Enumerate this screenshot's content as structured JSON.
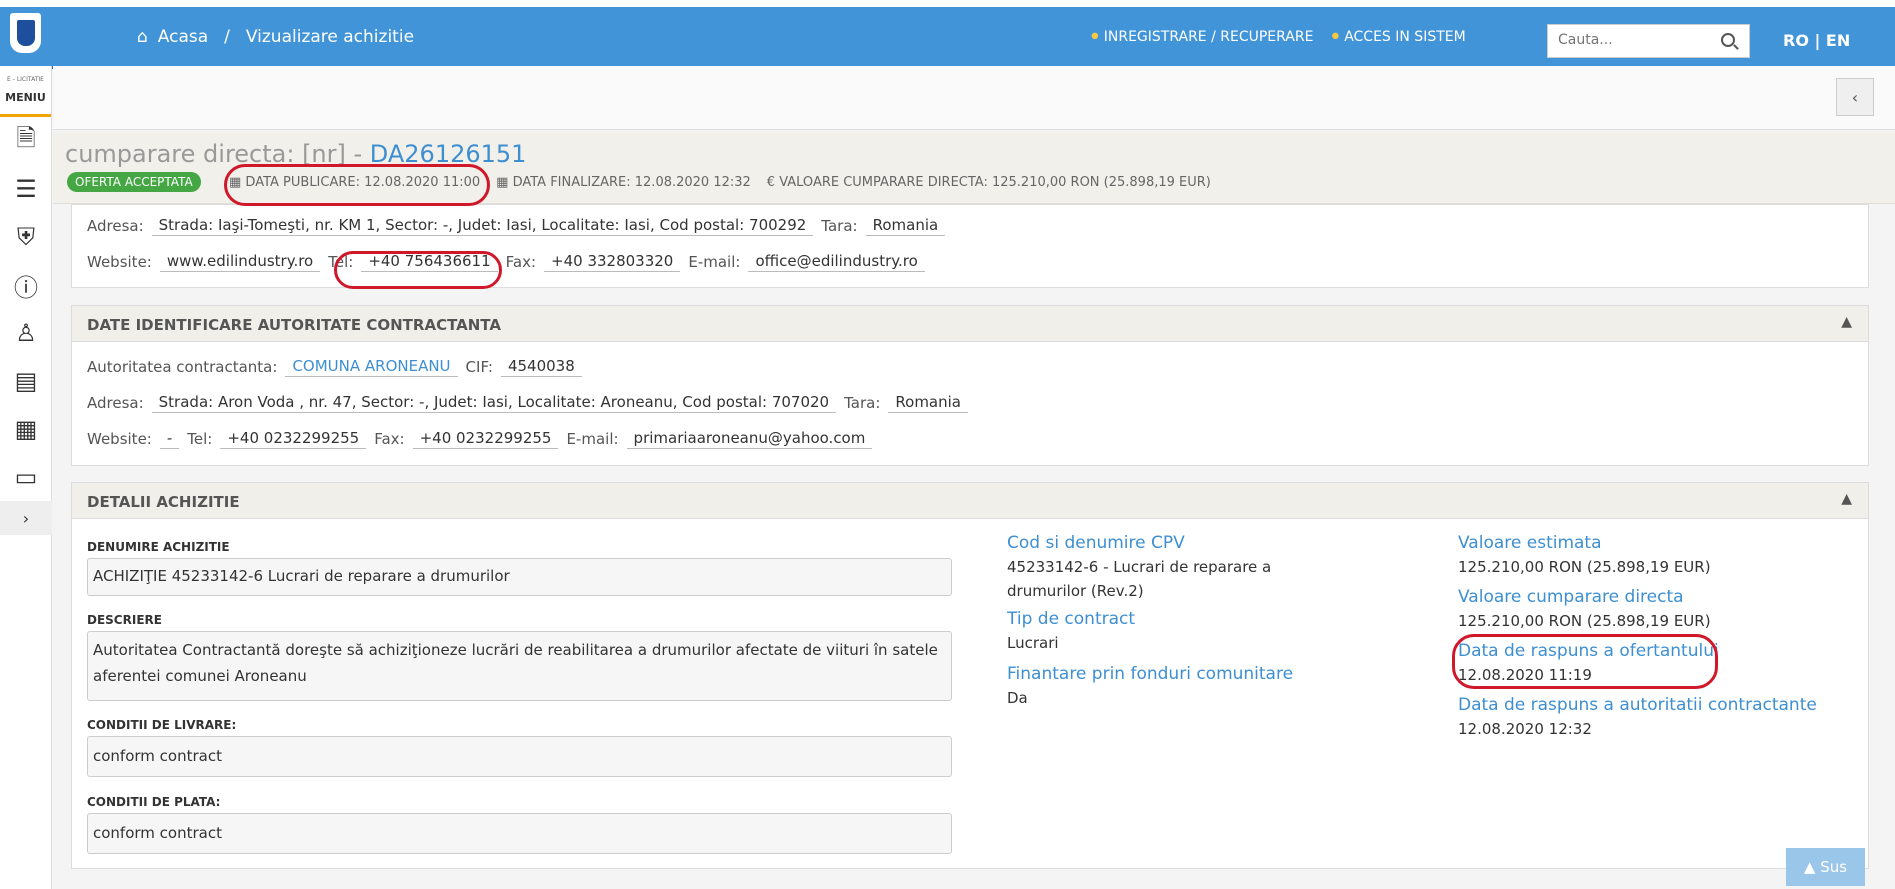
{
  "header": {
    "breadcrumb_home": "Acasa",
    "breadcrumb_sep": "/",
    "breadcrumb_current": "Vizualizare achizitie",
    "register_link": "INREGISTRARE / RECUPERARE",
    "login_link": "ACCES IN SISTEM",
    "search_placeholder": "Cauta...",
    "lang": "RO | EN"
  },
  "sidebar": {
    "brand": "E - LICITATIE",
    "menu_label": "MENIU",
    "icons": [
      "document-icon",
      "list-export-icon",
      "shield-check-icon",
      "help-icon",
      "person-money-icon",
      "id-card-icon",
      "archive-icon",
      "chat-icon"
    ]
  },
  "title": {
    "prefix": "cumparare directa: [nr] - ",
    "code": "DA26126151",
    "status_badge": "OFERTA ACCEPTATA",
    "date_published": "DATA PUBLICARE: 12.08.2020 11:00",
    "date_final": "DATA FINALIZARE: 12.08.2020 12:32",
    "value": "€ VALOARE CUMPARARE DIRECTA: 125.210,00  RON (25.898,19  EUR)"
  },
  "supplier": {
    "address_label": "Adresa:",
    "address": "Strada: Iaşi-Tomeşti, nr. KM 1, Sector: -, Judet: Iasi, Localitate: Iasi, Cod postal: 700292",
    "country_label": "Tara:",
    "country": "Romania",
    "website_label": "Website:",
    "website": "www.edilindustry.ro",
    "tel_label": "Tel:",
    "tel": "+40 756436611",
    "fax_label": "Fax:",
    "fax": "+40 332803320",
    "email_label": "E-mail:",
    "email": "office@edilindustry.ro"
  },
  "authority": {
    "heading": "DATE IDENTIFICARE AUTORITATE CONTRACTANTA",
    "name_label": "Autoritatea contractanta:",
    "name": "COMUNA ARONEANU",
    "cif_label": "CIF:",
    "cif": "4540038",
    "address_label": "Adresa:",
    "address": "Strada: Aron Voda , nr. 47, Sector: -, Judet: Iasi, Localitate: Aroneanu, Cod postal: 707020",
    "country_label": "Tara:",
    "country": "Romania",
    "website_label": "Website:",
    "website": "-",
    "tel_label": "Tel:",
    "tel": "+40 0232299255",
    "fax_label": "Fax:",
    "fax": "+40 0232299255",
    "email_label": "E-mail:",
    "email": "primariaaroneanu@yahoo.com"
  },
  "details": {
    "heading": "DETALII ACHIZITIE",
    "name_label": "DENUMIRE ACHIZITIE",
    "name": "ACHIZIŢIE 45233142-6 Lucrari de reparare a drumurilor",
    "desc_label": "DESCRIERE",
    "desc": "Autoritatea Contractantă doreşte să achiziţioneze lucrări de reabilitarea a drumurilor afectate de viituri în satele aferentei comunei Aroneanu",
    "delivery_label": "CONDITII DE LIVRARE:",
    "delivery": "conform contract",
    "payment_label": "CONDITII DE PLATA:",
    "payment": "conform contract",
    "cpv_label": "Cod si denumire CPV",
    "cpv": "45233142-6 - Lucrari de reparare a drumurilor (Rev.2)",
    "contract_type_label": "Tip de contract",
    "contract_type": "Lucrari",
    "eu_funds_label": "Finantare prin fonduri comunitare",
    "eu_funds": "Da",
    "est_value_label": "Valoare estimata",
    "est_value": "125.210,00  RON (25.898,19  EUR)",
    "direct_value_label": "Valoare cumparare directa",
    "direct_value": "125.210,00  RON (25.898,19  EUR)",
    "bidder_reply_label": "Data de raspuns a ofertantului",
    "bidder_reply": "12.08.2020 11:19",
    "authority_reply_label": "Data de raspuns a autoritatii contractante",
    "authority_reply": "12.08.2020 12:32"
  },
  "scroll_top": "Sus"
}
